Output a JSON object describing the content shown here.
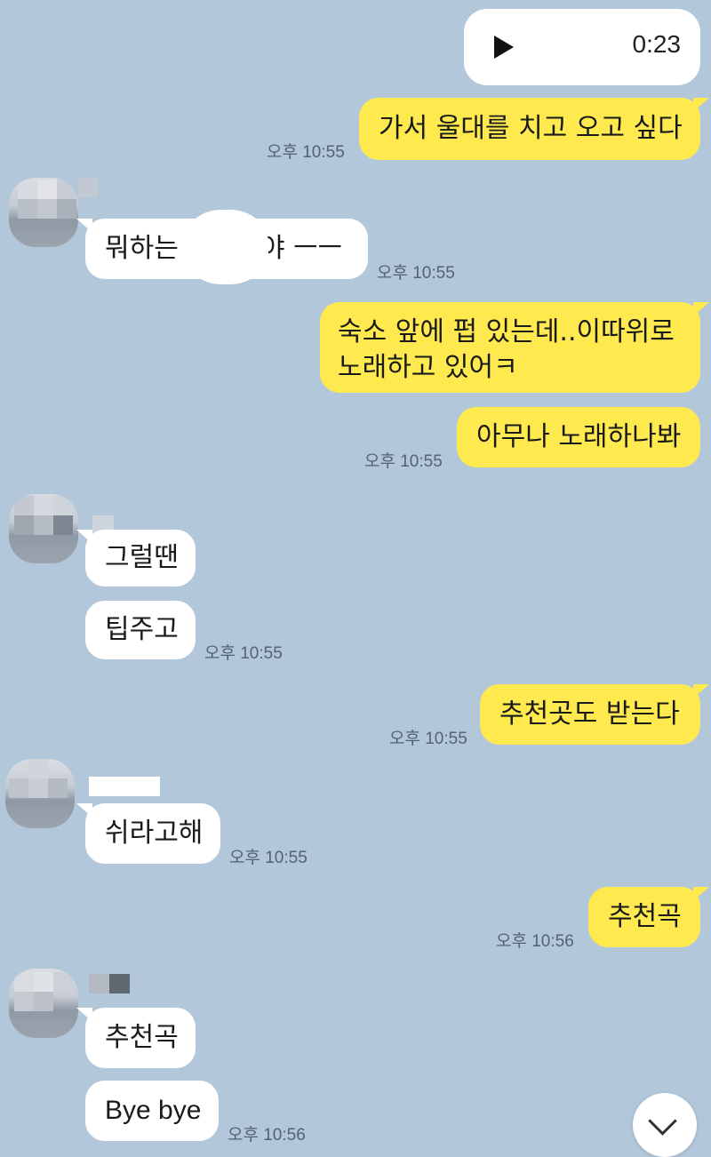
{
  "voice_message": {
    "duration": "0:23",
    "icon": "play-icon"
  },
  "messages": [
    {
      "id": "m1",
      "sender": "me",
      "text": "가서 울대를 치고 오고 싶다",
      "time": "오후 10:55"
    },
    {
      "id": "m2",
      "sender": "other",
      "text_before": "뭐하는",
      "text_after": "야 ㅡㅡ",
      "time": "오후 10:55"
    },
    {
      "id": "m3",
      "sender": "me",
      "lines": [
        "숙소 앞에 펍 있는데..이따위로",
        "노래하고 있어ㅋ"
      ]
    },
    {
      "id": "m4",
      "sender": "me",
      "text": "아무나 노래하나봐",
      "time": "오후 10:55"
    },
    {
      "id": "m5",
      "sender": "other",
      "text": "그럴땐"
    },
    {
      "id": "m6",
      "sender": "other",
      "text": "팁주고",
      "time": "오후 10:55"
    },
    {
      "id": "m7",
      "sender": "me",
      "text": "추천곳도 받는다",
      "time": "오후 10:55"
    },
    {
      "id": "m8",
      "sender": "other",
      "text": "쉬라고해",
      "time": "오후 10:55"
    },
    {
      "id": "m9",
      "sender": "me",
      "text": "추천곡",
      "time": "오후 10:56"
    },
    {
      "id": "m10",
      "sender": "other",
      "text": "추천곡"
    },
    {
      "id": "m11",
      "sender": "other",
      "text": "Bye bye",
      "time": "오후 10:56"
    }
  ],
  "colors": {
    "background": "#b2c7da",
    "my_bubble": "#fee94f",
    "other_bubble": "#ffffff"
  },
  "scroll_button": {
    "icon": "chevron-down-icon"
  }
}
